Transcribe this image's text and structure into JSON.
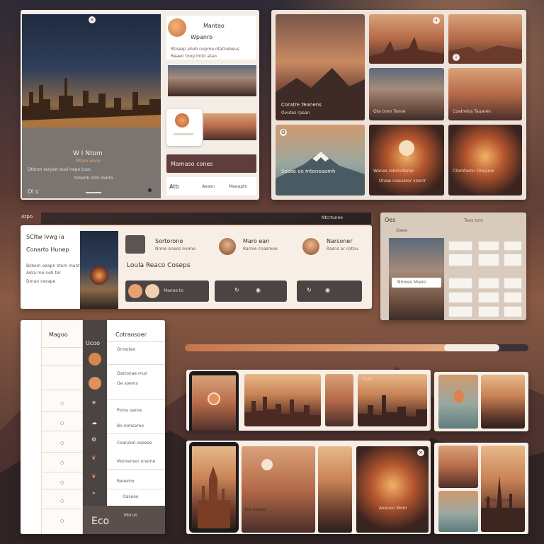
{
  "colors": {
    "accent": "#d9864e",
    "dark_panel": "#4a4543",
    "plum": "#5e3d3c",
    "cream": "#f4ede6"
  },
  "p1": {
    "hero_title": "W I Ntom",
    "hero_line1": "Mtaro wane",
    "hero_body1": "Dtbnm tanjest acel nepo tuoc",
    "hero_body2": "tohenb ntm mmto",
    "corner_label": "OI c",
    "card_title": "Mantao",
    "card_sub": "Wpanro",
    "card_body1": "Rtoaep ahob nupme otatnebeus",
    "card_body2": "Reaen toop lmto atao",
    "plum_label": "Mamaso cones",
    "footer_a": "Atb",
    "footer_b": "Aeesn",
    "footer_c": "Meeaptn"
  },
  "p2": {
    "t1": "Coratre Teanens",
    "t1b": "Ovutes rpaan",
    "t2": "Ota tono Tanoe",
    "t3": "Coatrelos Tauaren",
    "t4": "Seose oe mteneaamh",
    "t5": "Wanes rolemrtener",
    "t5b": "Onaw naouaror vnerrr",
    "t6": "Ctomtamn Oneanor",
    "badge": "O"
  },
  "p3": {
    "left_label": "Atpo",
    "right_label": "Ntcrtuneo",
    "title1": "SCItw Ivwg ia",
    "title2": "Conarto Hunep",
    "body1": "Bsbem oeapn stom mantu",
    "body2": "Adra mo neh ter",
    "body3": "Doran nerape",
    "c1_title": "Sortorono",
    "c1_body": "Nrme aneos mome",
    "c2_title": "Maro ean",
    "c2_body": "Rarme cnasmoe",
    "c3_title": "Narsoner",
    "c3_body": "Rasns ar cotnu",
    "big_line": "Loula Reaco Coseps",
    "bar1": "Manoe to",
    "panel_title": "Oes",
    "panel_sub": "Oaea",
    "panel_head": "Taes tom",
    "panel_btn": "Nmoes Msero"
  },
  "p4": {
    "col1_head": "Magoo",
    "col3_head": "Cotraosoer",
    "dark_label": "Ucoo",
    "rows": [
      "Ormoteo",
      "Oartonae mun",
      "Oe soems",
      "Poms oanre",
      "Bo romsemo",
      "Ceanoon oseese",
      "Momemen oneme",
      "Reoemo",
      "Oaseoo"
    ],
    "footer_title": "Eco",
    "footer_note": "Moruo"
  },
  "p5": {
    "t1": "Onte",
    "t2": "Am aeaoe",
    "t3": "Aeeuoo Wom",
    "t4": "Antioi Etone",
    "t4b": "Rseoseenes"
  },
  "progress": {
    "value": 0.86
  }
}
